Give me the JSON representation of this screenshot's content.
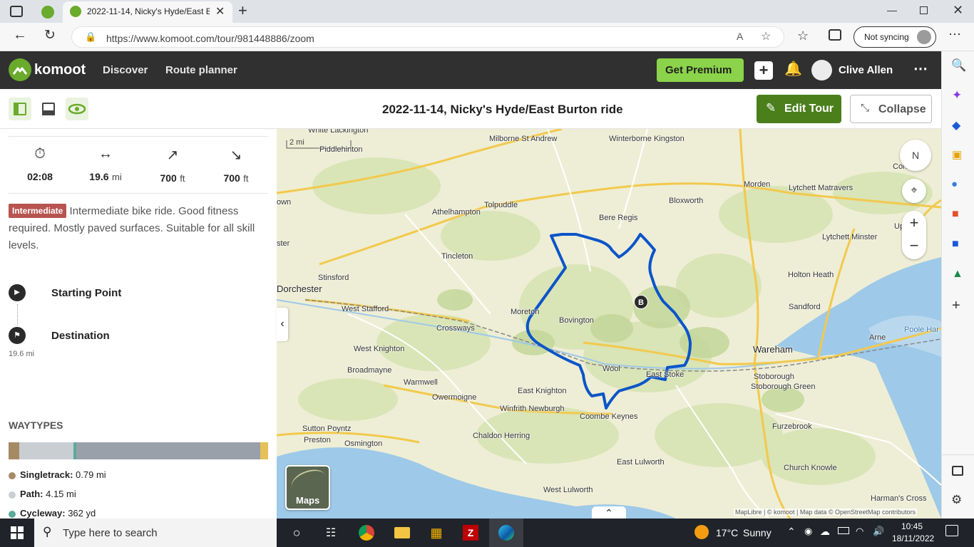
{
  "browser": {
    "tab_title": "2022-11-14, Nicky's Hyde/East B",
    "url": "https://www.komoot.com/tour/981448886/zoom",
    "sync_label": "Not syncing"
  },
  "header": {
    "logo": "komoot",
    "nav": [
      "Discover",
      "Route planner"
    ],
    "premium": "Get Premium",
    "user": "Clive Allen"
  },
  "tour": {
    "title": "2022-11-14, Nicky's Hyde/East Burton ride",
    "edit_label": "Edit Tour",
    "collapse_label": "Collapse"
  },
  "stats": {
    "duration": "02:08",
    "distance": "19.6",
    "distance_unit": "mi",
    "up": "700",
    "up_unit": "ft",
    "down": "700",
    "down_unit": "ft"
  },
  "difficulty": {
    "badge": "Intermediate",
    "text": "Intermediate bike ride. Good fitness required. Mostly paved surfaces. Suitable for all skill levels."
  },
  "waypoints": {
    "start": "Starting Point",
    "destination": "Destination",
    "distance": "19.6 mi"
  },
  "waytypes": {
    "heading": "WAYTYPES",
    "items": [
      {
        "name": "Singletrack:",
        "value": "0.79 mi",
        "color": "#a68a64"
      },
      {
        "name": "Path:",
        "value": "4.15 mi",
        "color": "#c9ced3"
      },
      {
        "name": "Cycleway:",
        "value": "362 yd",
        "color": "#5aab9a"
      }
    ],
    "bar": [
      {
        "fraction": 0.04,
        "color": "#a68a64"
      },
      {
        "fraction": 0.21,
        "color": "#c9ced3"
      },
      {
        "fraction": 0.01,
        "color": "#5aab9a"
      },
      {
        "fraction": 0.71,
        "color": "#9aa0aa"
      },
      {
        "fraction": 0.03,
        "color": "#e6c15a"
      }
    ]
  },
  "map": {
    "scale": "2 mi",
    "compass": "N",
    "maps_label": "Maps",
    "attribution": "MapLibre | © komoot | Map data © OpenStreetMap contributors",
    "marker": "B",
    "places": [
      "White Lackington",
      "Piddlehinton",
      "Milborne St Andrew",
      "Winterborne Kingston",
      "Corfe",
      "Morden",
      "Lytchett Matravers",
      "Bere Regis",
      "Bloxworth",
      "Athelhampton",
      "Tolpuddle",
      "Lytchett Minster",
      "Upton",
      "Tincleton",
      "Stinsford",
      "Holton Heath",
      "Dorchester",
      "West Stafford",
      "Moreton",
      "Bovington",
      "Sandford",
      "Crossways",
      "Arne",
      "Poole Har",
      "West Knighton",
      "Wareham",
      "Broadmayne",
      "Wool",
      "East Stoke",
      "Stoborough",
      "Stoborough Green",
      "Warmwell",
      "Owermoigne",
      "East Knighton",
      "Winfrith Newburgh",
      "Coombe Keynes",
      "Furzebrook",
      "Sutton Poyntz",
      "Preston",
      "Osmington",
      "Chaldon Herring",
      "East Lulworth",
      "Church Knowle",
      "West Lulworth",
      "Harman's Cross",
      "own",
      "ster"
    ]
  },
  "taskbar": {
    "search": "Type here to search",
    "weather_temp": "17°C",
    "weather_text": "Sunny",
    "time": "10:45",
    "date": "18/11/2022"
  },
  "colors": {
    "accent": "#6aaa2c",
    "premium": "#8bd34a",
    "route": "#0a55c9",
    "badge": "#b85450"
  }
}
